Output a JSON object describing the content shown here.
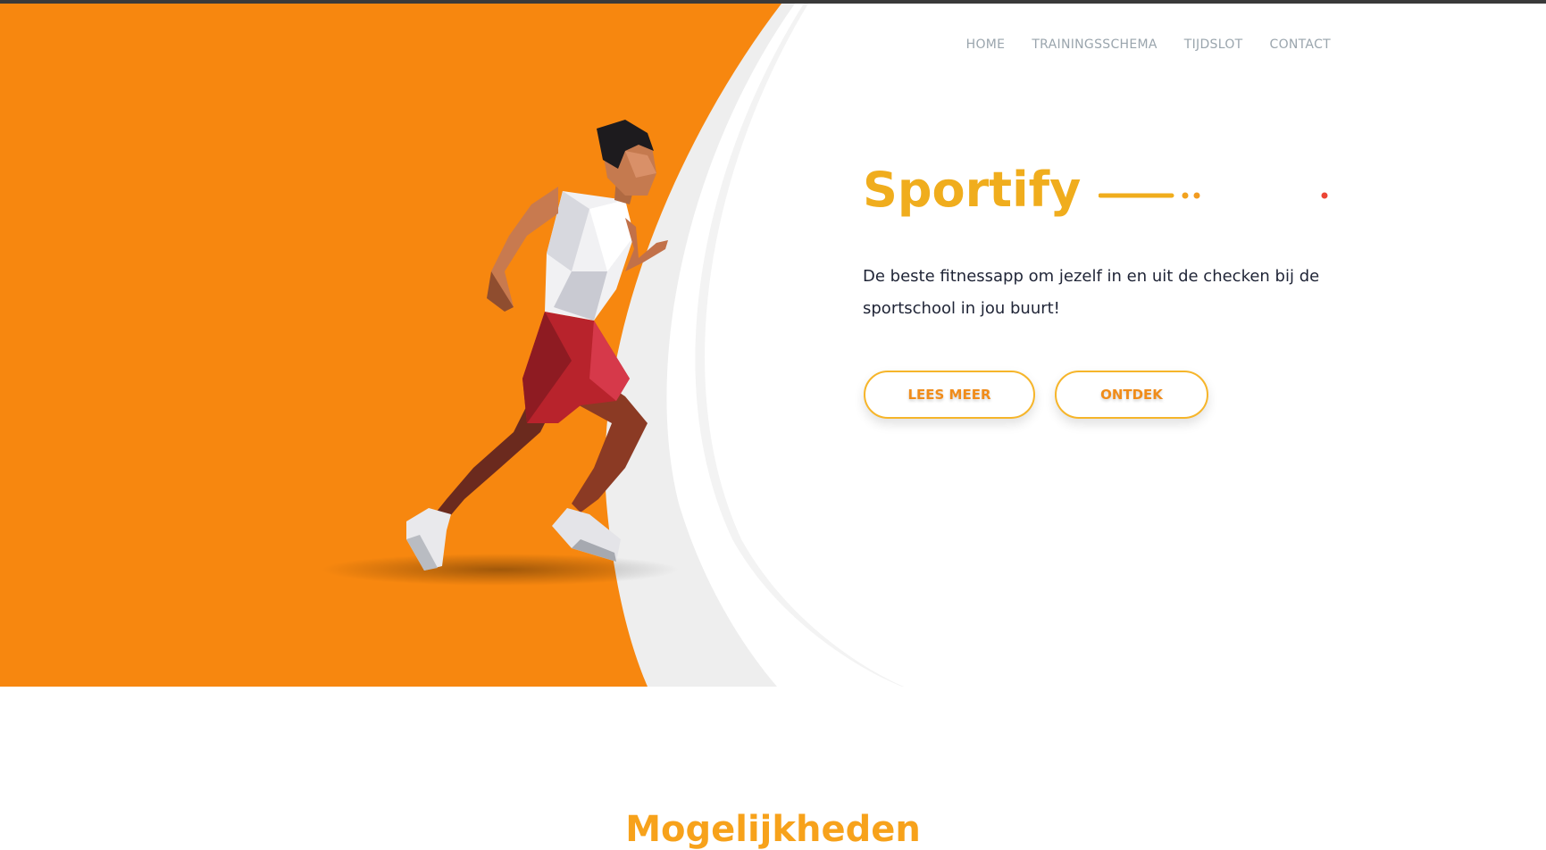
{
  "nav": {
    "items": [
      "HOME",
      "TRAININGSSCHEMA",
      "TIJDSLOT",
      "CONTACT"
    ]
  },
  "hero": {
    "brand": "Sportify",
    "tagline": "De beste fitnessapp om jezelf in en uit de checken bij de sportschool in jou buurt!",
    "buttons": {
      "read_more": "LEES MEER",
      "discover": "ONTDEK"
    },
    "illustration": "low-poly-runner"
  },
  "section": {
    "title": "Mogelijkheden"
  },
  "colors": {
    "orange": "#f7870f",
    "brand_yellow": "#f0ad1d",
    "button_text": "#f08c1a",
    "nav_text": "#9aa5ad",
    "body_text": "#1f2436"
  }
}
